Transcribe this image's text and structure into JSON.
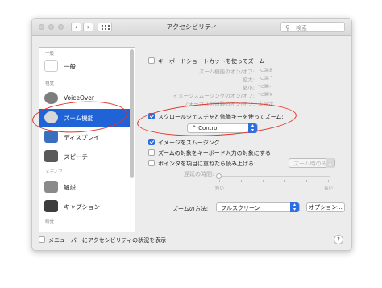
{
  "window": {
    "title": "アクセシビリティ",
    "search_placeholder": "検索",
    "nav_back": "‹",
    "nav_forward": "›"
  },
  "sidebar": {
    "sections": {
      "general": "一般",
      "vision": "視覚",
      "media": "メディア",
      "hearing": "聴覚"
    },
    "items": [
      {
        "label": "一般"
      },
      {
        "label": "VoiceOver"
      },
      {
        "label": "ズーム機能"
      },
      {
        "label": "ディスプレイ"
      },
      {
        "label": "スピーチ"
      },
      {
        "label": "解説"
      },
      {
        "label": "キャプション"
      }
    ]
  },
  "zoom": {
    "keyboard_shortcuts": "キーボードショートカットを使ってズーム",
    "shortcuts": [
      {
        "key": "ズーム機能のオン/オフ:",
        "value": "⌥⌘8"
      },
      {
        "key": "拡大:",
        "value": "⌥⌘^"
      },
      {
        "key": "縮小:",
        "value": "⌥⌘-"
      },
      {
        "key": "イメージスムージングのオン/オフ:",
        "value": "⌥⌘¥"
      },
      {
        "key": "フォーカスの追跡のオン/オフ:",
        "value": "未設定"
      }
    ],
    "scroll_gesture": "スクロールジェスチャと修飾キーを使ってズーム:",
    "modifier_value": "^ Control",
    "smooth_images": "イメージをスムージング",
    "follow_focus": "ズームの対象をキーボード入力の対象にする",
    "hover_text": "ポインタを項目に重ねたら読み上げる:",
    "hover_popup": "ズーム時のみ",
    "speak_delay": "遅延の時間:",
    "speak_delay_level": 0,
    "slider_short": "短い",
    "slider_long": "長い",
    "zoom_style_label": "ズームの方法:",
    "zoom_style_value": "フルスクリーン",
    "options_button": "オプション..."
  },
  "footer": {
    "menu_bar_status": "メニューバーにアクセシビリティの状況を表示",
    "help": "?"
  },
  "colors": {
    "selection": "#1f63d6",
    "annotation": "#e0342b"
  }
}
